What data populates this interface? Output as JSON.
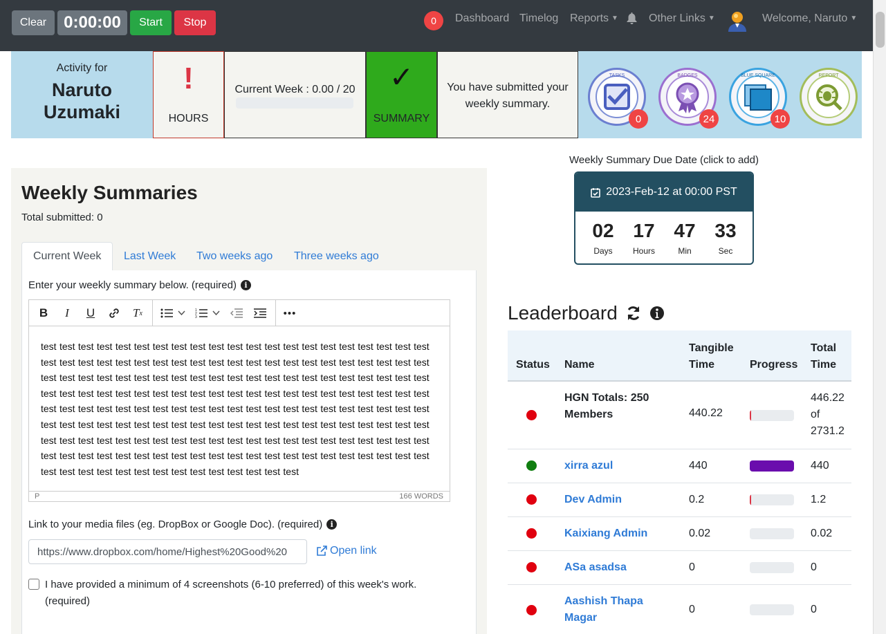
{
  "navbar": {
    "clear_label": "Clear",
    "timer": "0:00:00",
    "start_label": "Start",
    "stop_label": "Stop",
    "notification_count": "0",
    "links": {
      "dashboard": "Dashboard",
      "timelog": "Timelog",
      "reports": "Reports",
      "other_links": "Other Links",
      "welcome": "Welcome, Naruto"
    }
  },
  "header": {
    "activity_label": "Activity for",
    "name_first": "Naruto",
    "name_last": "Uzumaki",
    "hours_mark": "!",
    "hours_label": "HOURS",
    "current_week": "Current Week : 0.00 / 20",
    "current_week_fill": 0,
    "summary_check": "✓",
    "summary_label": "SUMMARY",
    "submitted_text": "You have submitted your weekly summary.",
    "badges": [
      {
        "icon": "tasks-icon",
        "arc_top": "TASKS",
        "count": "0",
        "color": "#4a5fbf"
      },
      {
        "icon": "badges-earned-icon",
        "arc_top": "BADGES",
        "count": "24",
        "color": "#8b4fbf"
      },
      {
        "icon": "blue-square-record-icon",
        "arc_top": "BLUE SQUARE",
        "count": "10",
        "color": "#1e88c8"
      },
      {
        "icon": "report-app-bug-icon",
        "arc_top": "REPORT",
        "count": null,
        "color": "#8aa83b"
      }
    ]
  },
  "weekly_summaries": {
    "title": "Weekly Summaries",
    "total": "Total submitted: 0",
    "tabs": [
      "Current Week",
      "Last Week",
      "Two weeks ago",
      "Three weeks ago"
    ],
    "active_tab": 0,
    "editor_label": "Enter your weekly summary below. (required)",
    "editor_text": "test test test test test test test test test test test test test test test test test test test test test test test test test test test test test test test test test test test test test test test test test test test test test test test test test test test test test test test test test test test test test test test test test test test test test test test test test test test test test test test test test test test test test test test test test test test test test test test test test test test test test test test test test test test test test test test test test test test test test test test test test test test test test test test test test test test test test test test test test test test test test test test test test test test test test test test test test test test test test test test test test test test test test test test test test test test test test test test test test test test test test test",
    "status_path": "P",
    "word_count": "166 WORDS",
    "media_label": "Link to your media files (eg. DropBox or Google Doc). (required)",
    "media_value": "https://www.dropbox.com/home/Highest%20Good%20",
    "open_link": "Open link",
    "screenshots_label": "I have provided a minimum of 4 screenshots (6-10 preferred) of this week's work. (required)",
    "screenshots_checked": false
  },
  "due_date": {
    "label": "Weekly Summary Due Date (click to add)",
    "date": "2023-Feb-12 at 00:00 PST",
    "countdown": [
      {
        "value": "02",
        "unit": "Days"
      },
      {
        "value": "17",
        "unit": "Hours"
      },
      {
        "value": "47",
        "unit": "Min"
      },
      {
        "value": "33",
        "unit": "Sec"
      }
    ]
  },
  "leaderboard": {
    "title": "Leaderboard",
    "columns": {
      "status": "Status",
      "name": "Name",
      "tangible_1": "Tangible",
      "tangible_2": "Time",
      "progress": "Progress",
      "total_1": "Total",
      "total_2": "Time"
    },
    "totals_row": {
      "name": "HGN Totals: 250 Members",
      "tangible": "440.22",
      "total_1": "446.22",
      "total_2": "of",
      "total_3": "2731.2",
      "status_color": "#e0000f",
      "fill": 0.02,
      "fill_color": "#dc3545"
    },
    "rows": [
      {
        "name": "xirra azul",
        "tangible": "440",
        "total": "440",
        "status_color": "#107e10",
        "fill": 1.0,
        "fill_color": "#6a0dad"
      },
      {
        "name": "Dev Admin",
        "tangible": "0.2",
        "total": "1.2",
        "status_color": "#e0000f",
        "fill": 0.02,
        "fill_color": "#dc3545"
      },
      {
        "name": "Kaixiang Admin",
        "tangible": "0.02",
        "total": "0.02",
        "status_color": "#e0000f",
        "fill": 0,
        "fill_color": "#dc3545"
      },
      {
        "name": "ASa asadsa",
        "tangible": "0",
        "total": "0",
        "status_color": "#e0000f",
        "fill": 0,
        "fill_color": "#dc3545"
      },
      {
        "name": "Aashish Thapa Magar",
        "tangible": "0",
        "total": "0",
        "status_color": "#e0000f",
        "fill": 0,
        "fill_color": "#dc3545"
      }
    ]
  }
}
